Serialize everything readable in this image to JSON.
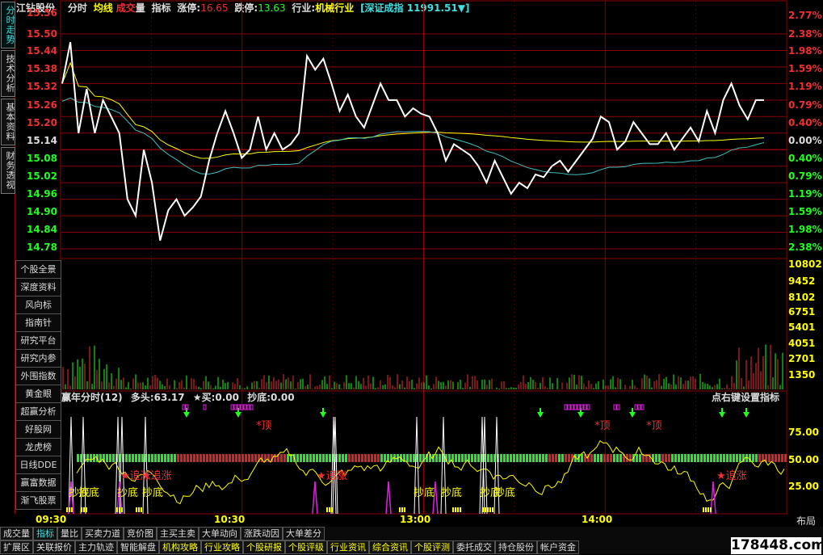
{
  "header": {
    "stock_name": "江钻股份",
    "mode": "分时",
    "avg_line_label": "均线",
    "volume_label_a": "成交",
    "volume_label_b": "量",
    "indicator_label": "指标",
    "limit_up_label": "涨停:",
    "limit_up_value": "16.65",
    "limit_down_label": "跌停:",
    "limit_down_value": "13.63",
    "industry_label": "行业:",
    "industry_value": "机械行业",
    "index_text": "[深证成指 11991.51▼]"
  },
  "left_tabs": [
    "分时走势",
    "技术分析",
    "基本资料",
    "财务透视"
  ],
  "side_menu": [
    "个股全景",
    "深度资料",
    "风向标",
    "指南针",
    "研究平台",
    "研究内参",
    "外围指数",
    "黄金眼",
    "超赢分析",
    "好股网",
    "龙虎榜",
    "日线DDE",
    "赢富数据",
    "渐飞股票"
  ],
  "price_axis": [
    "15.56",
    "15.50",
    "15.44",
    "15.38",
    "15.32",
    "15.26",
    "15.20",
    "15.14",
    "15.08",
    "15.02",
    "14.96",
    "14.90",
    "14.84",
    "14.78"
  ],
  "pct_axis": [
    "2.77%",
    "2.38%",
    "1.98%",
    "1.59%",
    "1.19%",
    "0.79%",
    "0.40%",
    "0.00%",
    "0.40%",
    "0.79%",
    "1.19%",
    "1.59%",
    "1.98%",
    "2.38%"
  ],
  "volume_axis": [
    "10802",
    "9452",
    "8102",
    "6751",
    "5401",
    "4051",
    "2701",
    "1350"
  ],
  "indicator_axis": [
    "75.00",
    "50.00",
    "25.00"
  ],
  "time_axis": [
    "09:30",
    "10:30",
    "13:00",
    "14:00"
  ],
  "indicator_title": {
    "name": "赢年分时(12)",
    "bull_label": "多头:",
    "bull_value": "63.17",
    "buy_label": "★买:",
    "buy_value": "0.00",
    "bottom_label": "抄底:",
    "bottom_value": "0.00",
    "hint": "点右键设置指标"
  },
  "signals": {
    "top": "*顶",
    "chase": "★追涨",
    "bottom": "抄底"
  },
  "layout_button": "布局",
  "tabs_row1": [
    "成交量",
    "指标",
    "量比",
    "买卖力道",
    "竞价图",
    "主买主卖",
    "大单动向",
    "涨跌动因",
    "大单差分"
  ],
  "tabs_row2": [
    "扩展区",
    "关联报价",
    "主力轨迹",
    "智能解盘",
    "机构攻略",
    "行业攻略",
    "个股研报",
    "个股评级",
    "行业资讯",
    "综合资讯",
    "个股评测",
    "委托成交",
    "持仓股份",
    "帐户资金"
  ],
  "watermark": "178448.com",
  "colors": {
    "up_red": "#f03030",
    "down_green": "#20ff20",
    "yellow": "#ffff00",
    "cyan": "#40e0e0",
    "grid": "#8b0000"
  },
  "chart_data": {
    "type": "line",
    "title": "",
    "xlabel": "",
    "ylabel": "",
    "prev_close": 15.14,
    "ylim": [
      14.78,
      15.56
    ],
    "x_ticks": [
      "09:30",
      "10:30",
      "13:00",
      "14:00"
    ],
    "series": [
      {
        "values": [
          15.38,
          15.53,
          15.2,
          15.36,
          15.2,
          15.32,
          15.26,
          15.2,
          14.96,
          14.9,
          15.14,
          15.02,
          14.81,
          14.92,
          14.96,
          14.9,
          14.93,
          14.97,
          15.1,
          15.2,
          15.28,
          15.2,
          15.11,
          15.14,
          15.26,
          15.14,
          15.2,
          15.14,
          15.16,
          15.2,
          15.48,
          15.43,
          15.47,
          15.38,
          15.28,
          15.34,
          15.26,
          15.22,
          15.3,
          15.38,
          15.32,
          15.32,
          15.26,
          15.29,
          15.27,
          15.26,
          15.2,
          15.1,
          15.16,
          15.14,
          15.12,
          15.08,
          15.02,
          15.1,
          15.04,
          14.98,
          15.02,
          15.0,
          15.05,
          15.04,
          15.08,
          15.1,
          15.06,
          15.1,
          15.14,
          15.18,
          15.26,
          15.24,
          15.14,
          15.17,
          15.24,
          15.2,
          15.16,
          15.16,
          15.2,
          15.14,
          15.18,
          15.22,
          15.17,
          15.28,
          15.2,
          15.32,
          15.38,
          15.3,
          15.25,
          15.32,
          15.32
        ],
        "name": ""
      }
    ],
    "volume_ylim": [
      0,
      10802
    ],
    "indicator_ylim": [
      0,
      100
    ]
  }
}
